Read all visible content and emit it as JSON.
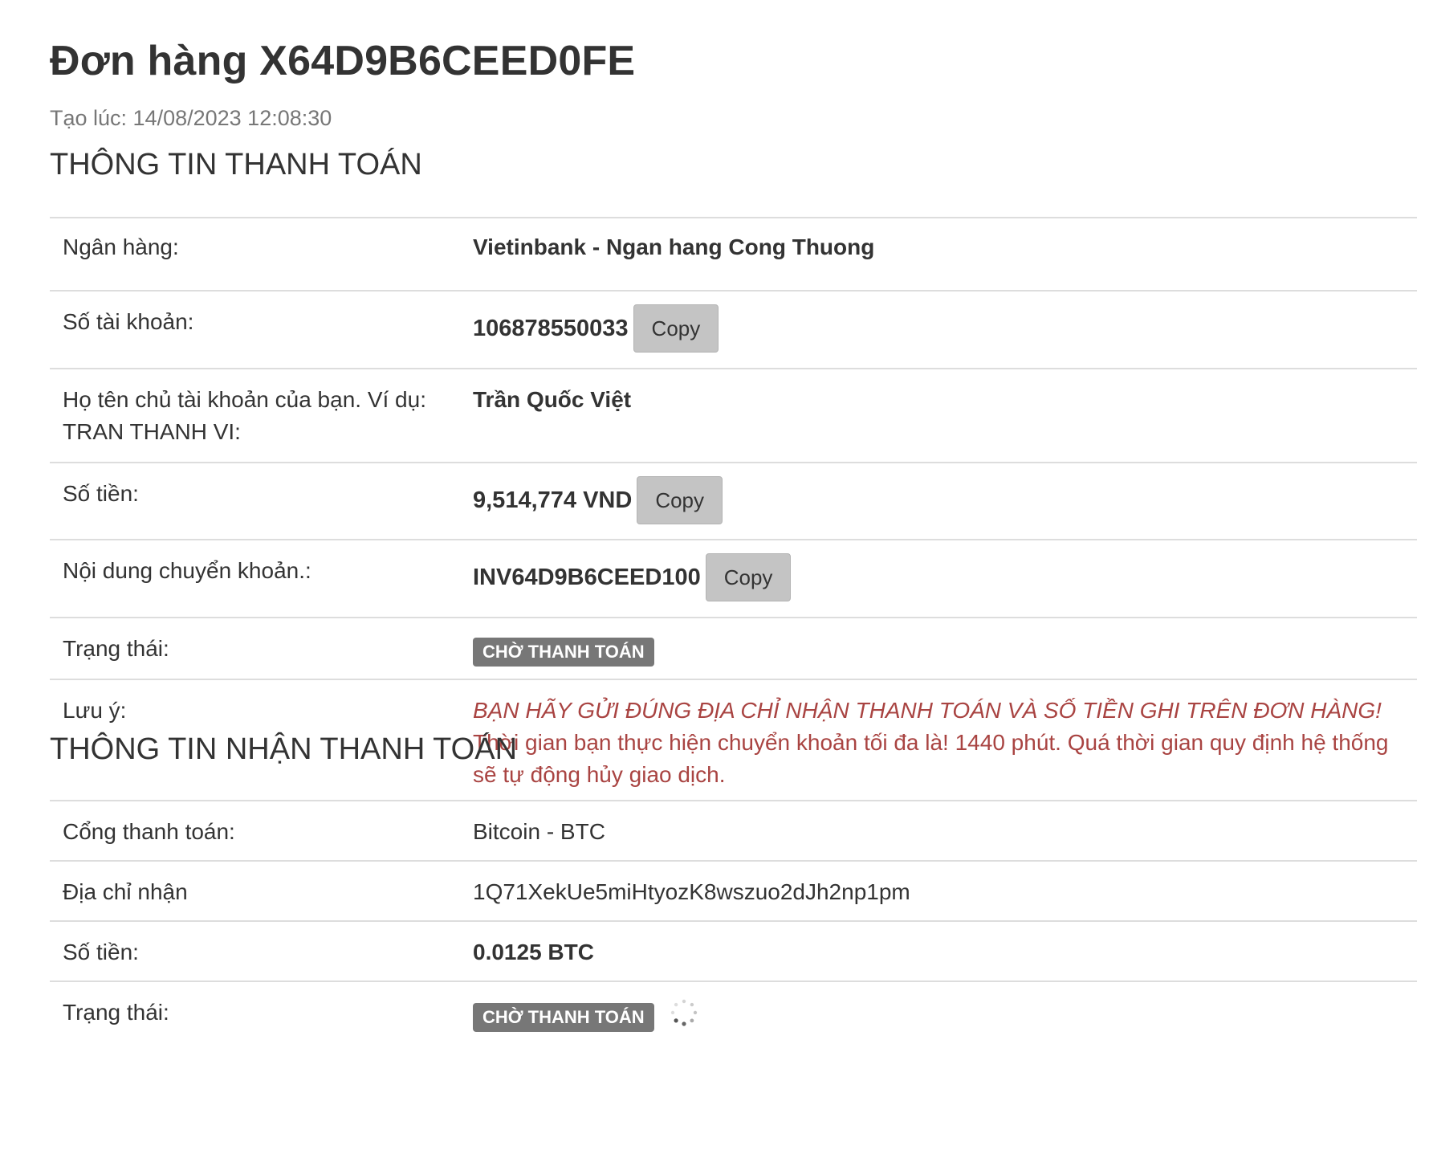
{
  "order": {
    "title": "Đơn hàng X64D9B6CEED0FE",
    "created_at": "Tạo lúc: 14/08/2023 12:08:30"
  },
  "payment_info": {
    "heading": "THÔNG TIN THANH TOÁN",
    "bank_label": "Ngân hàng:",
    "bank_value": "Vietinbank - Ngan hang Cong Thuong",
    "account_label": "Số tài khoản:",
    "account_value": "106878550033",
    "holder_label": "Họ tên chủ tài khoản của bạn. Ví dụ: TRAN THANH VI:",
    "holder_value": "Trần Quốc Việt",
    "amount_label": "Số tiền:",
    "amount_value": "9,514,774 VND",
    "content_label": "Nội dung chuyển khoản.:",
    "content_value": "INV64D9B6CEED100",
    "status_label": "Trạng thái:",
    "status_value": "CHỜ THANH TOÁN",
    "note_label": "Lưu ý:",
    "note_warning": "BẠN HÃY GỬI ĐÚNG ĐỊA CHỈ NHẬN THANH TOÁN VÀ SỐ TIỀN GHI TRÊN ĐƠN HÀNG!",
    "note_text": "Thời gian bạn thực hiện chuyển khoản tối đa là! 1440 phút. Quá thời gian quy định hệ thống sẽ tự động hủy giao dịch.",
    "copy_label": "Copy"
  },
  "receive_info": {
    "heading": "THÔNG TIN NHẬN THANH TOÁN",
    "gateway_label": "Cổng thanh toán:",
    "gateway_value": "Bitcoin - BTC",
    "address_label": "Địa chỉ nhận",
    "address_value": "1Q71XekUe5miHtyozK8wszuo2dJh2np1pm",
    "amount_label": "Số tiền:",
    "amount_value": "0.0125 BTC",
    "status_label": "Trạng thái:",
    "status_value": "CHỜ THANH TOÁN"
  },
  "icons": {
    "loading": "loading-spinner-icon"
  },
  "colors": {
    "warning": "#a94442",
    "badge": "#777777",
    "copy_button": "#c4c4c4"
  }
}
